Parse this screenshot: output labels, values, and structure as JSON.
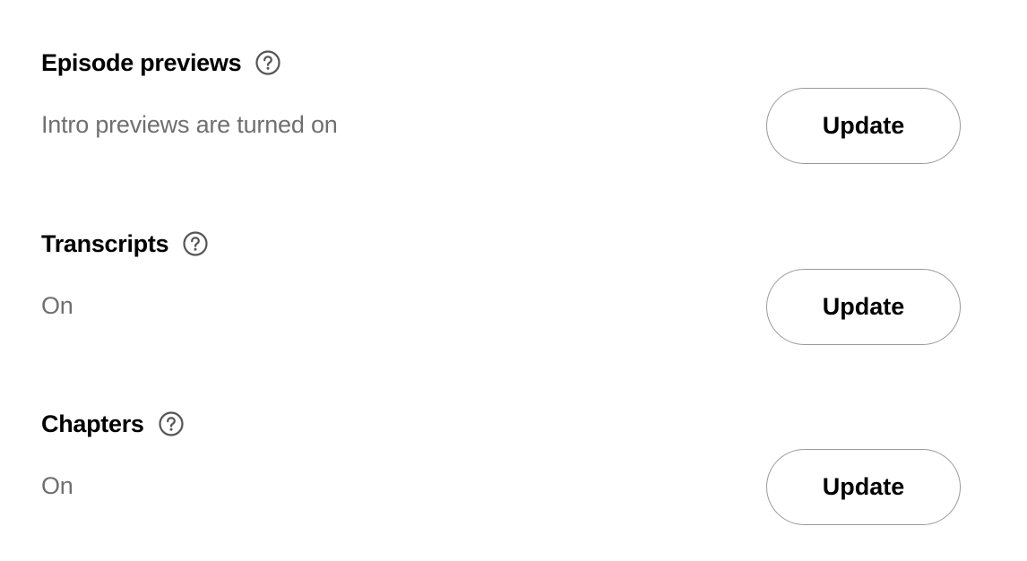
{
  "sections": [
    {
      "title": "Episode previews",
      "help_icon": "question-circle-icon",
      "status": "Intro previews are turned on",
      "button_label": "Update"
    },
    {
      "title": "Transcripts",
      "help_icon": "question-circle-icon",
      "status": "On",
      "button_label": "Update"
    },
    {
      "title": "Chapters",
      "help_icon": "question-circle-icon",
      "status": "On",
      "button_label": "Update"
    }
  ],
  "colors": {
    "title": "#000000",
    "status": "#6f6f6f",
    "button_border": "#9a9a9a",
    "icon": "#555555",
    "background": "#ffffff"
  }
}
